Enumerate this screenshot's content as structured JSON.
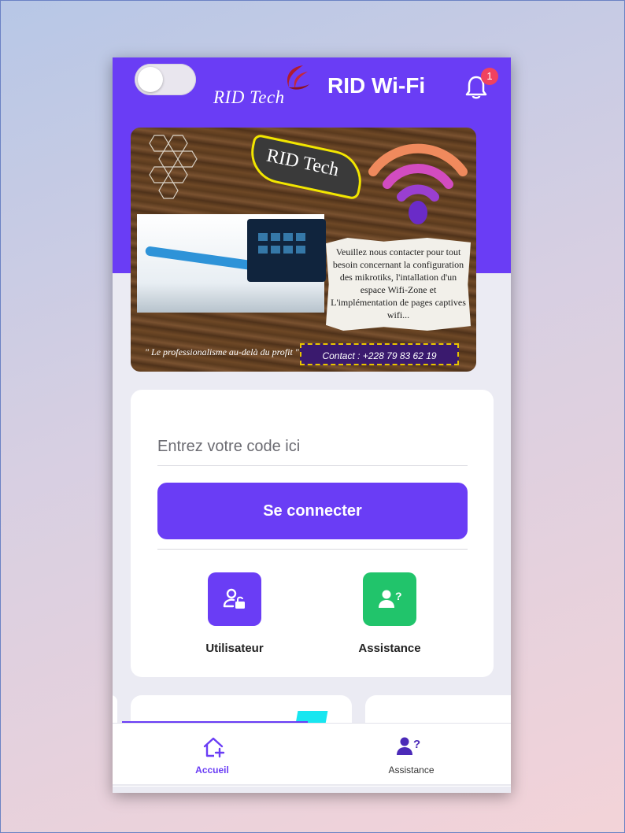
{
  "header": {
    "brand": "RID Tech",
    "title": "RID Wi-Fi",
    "notification_count": "1",
    "toggle_on": false
  },
  "banner": {
    "label": "RID Tech",
    "note": "Veuillez nous contacter pour tout besoin concernant la configuration des mikrotiks, l'intallation d'un espace Wifi-Zone et L'implémentation de pages captives wifi...",
    "slogan": "\" Le professionalisme au-delà du profit \"",
    "contact": "Contact : +228 79 83 62 19"
  },
  "login": {
    "placeholder": "Entrez votre code ici",
    "button_label": "Se connecter"
  },
  "shortcuts": [
    {
      "label": "Utilisateur",
      "icon": "user-lock-icon",
      "color": "#6a3df5"
    },
    {
      "label": "Assistance",
      "icon": "user-question-icon",
      "color": "#21c46b"
    }
  ],
  "bottom_nav": [
    {
      "label": "Accueil",
      "icon": "home-plus-icon",
      "active": true
    },
    {
      "label": "Assistance",
      "icon": "user-question-icon",
      "active": false
    }
  ],
  "colors": {
    "accent": "#6a3df5",
    "success": "#21c46b",
    "badge": "#f0425f"
  }
}
